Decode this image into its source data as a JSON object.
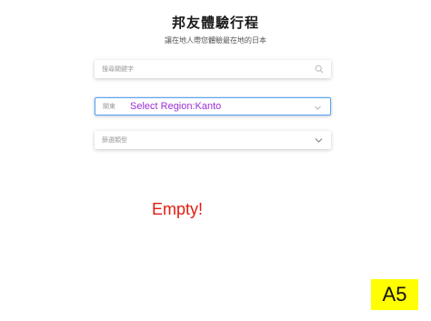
{
  "header": {
    "title": "邦友體驗行程",
    "subtitle": "讓在地人帶您體驗最在地的日本"
  },
  "search": {
    "placeholder": "搜尋關鍵字",
    "icon": "search-icon"
  },
  "region_select": {
    "label": "關東",
    "selection_annotation": "Select Region:Kanto",
    "annotation_color": "#9b30d6",
    "focus_border_color": "#5aa6f0"
  },
  "type_select": {
    "placeholder": "篩選類型"
  },
  "results": {
    "empty_message": "Empty!",
    "empty_color": "#e21b0f"
  },
  "badge": {
    "label": "A5",
    "color": "#ffff00"
  }
}
